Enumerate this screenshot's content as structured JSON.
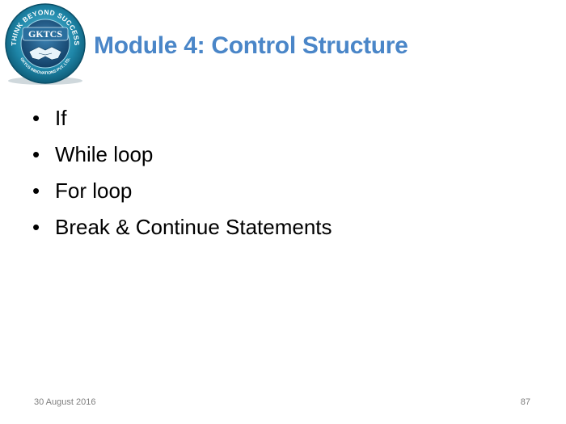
{
  "logo": {
    "ring_text": "THINK BEYOND SUCCESS",
    "brand": "GKTCS",
    "company": "GKTCS INNOVATIONS PVT. LTD.",
    "ring_color": "#1e86a8",
    "inner_color": "#1a4f7a",
    "icon": "handshake-icon"
  },
  "slide": {
    "title": "Module 4: Control Structure",
    "title_color": "#4a86c8",
    "bullets": [
      "If",
      "While loop",
      "For loop",
      "Break & Continue Statements"
    ]
  },
  "footer": {
    "date": "30 August 2016",
    "page_number": "87"
  }
}
